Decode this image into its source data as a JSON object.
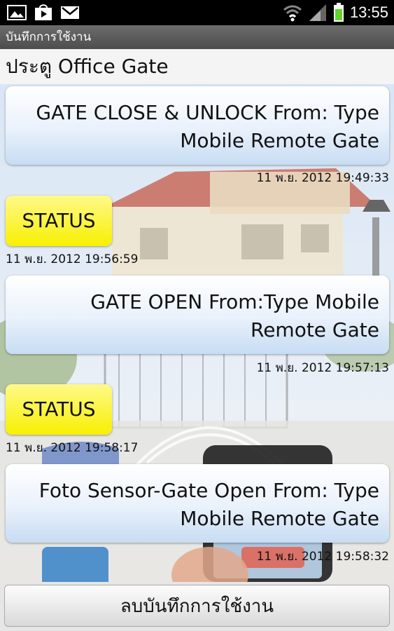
{
  "statusbar": {
    "time": "13:55",
    "left_icons": [
      "gallery-icon",
      "play-store-icon",
      "gmail-icon"
    ],
    "right_icons": [
      "wifi-icon",
      "signal-icon",
      "battery-icon"
    ]
  },
  "titlebar": {
    "title": "บันทึกการใช้งาน"
  },
  "header": {
    "title": "ประตู Office Gate"
  },
  "log": [
    {
      "kind": "message",
      "text": "GATE CLOSE & UNLOCK From: Type Mobile Remote Gate",
      "time": "11 พ.ย. 2012 19:49:33"
    },
    {
      "kind": "status",
      "text": "STATUS",
      "time": "11 พ.ย. 2012 19:56:59"
    },
    {
      "kind": "message",
      "text": "GATE OPEN From:Type Mobile Remote Gate",
      "time": "11 พ.ย. 2012 19:57:13"
    },
    {
      "kind": "status",
      "text": "STATUS",
      "time": "11 พ.ย. 2012 19:58:17"
    },
    {
      "kind": "message",
      "text": "Foto Sensor-Gate Open From: Type Mobile Remote Gate",
      "time": "11 พ.ย. 2012 19:58:32"
    }
  ],
  "bottom": {
    "delete_label": "ลบบันทึกการใช้งาน"
  },
  "colors": {
    "status_yellow": "#f7f000",
    "bubble_blue": "#c7dcf3"
  }
}
